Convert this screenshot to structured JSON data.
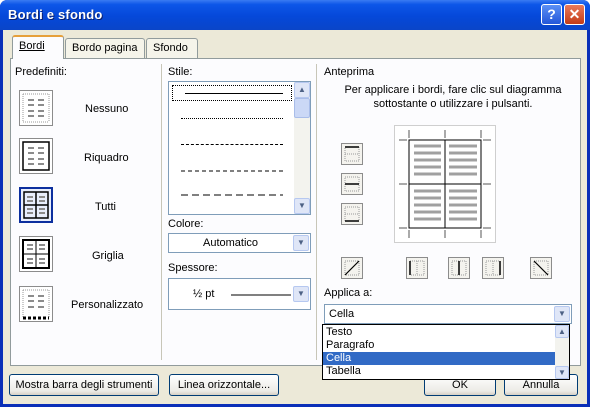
{
  "window": {
    "title": "Bordi e sfondo",
    "help_glyph": "?",
    "close_glyph": "✕"
  },
  "tabs": [
    {
      "label": "Bordi",
      "active": true
    },
    {
      "label": "Bordo pagina",
      "active": false
    },
    {
      "label": "Sfondo",
      "active": false
    }
  ],
  "presets": {
    "heading": "Predefiniti:",
    "items": [
      {
        "label": "Nessuno",
        "icon": "border-none-icon",
        "selected": false
      },
      {
        "label": "Riquadro",
        "icon": "border-box-icon",
        "selected": false
      },
      {
        "label": "Tutti",
        "icon": "border-all-icon",
        "selected": true
      },
      {
        "label": "Griglia",
        "icon": "border-grid-icon",
        "selected": false
      },
      {
        "label": "Personalizzato",
        "icon": "border-custom-icon",
        "selected": false
      }
    ]
  },
  "style": {
    "heading": "Stile:",
    "line_styles": [
      "solid",
      "dotted-fine",
      "dashed-small",
      "dashed-medium",
      "dash-dot",
      "dashed-long"
    ],
    "selected_index": 0
  },
  "color": {
    "label": "Colore:",
    "value": "Automatico"
  },
  "width": {
    "label": "Spessore:",
    "value": "½ pt"
  },
  "preview": {
    "heading": "Anteprima",
    "instructions": "Per applicare i bordi, fare clic sul diagramma sottostante o utilizzare i pulsanti."
  },
  "apply_to": {
    "label": "Applica a:",
    "value": "Cella",
    "options": [
      "Testo",
      "Paragrafo",
      "Cella",
      "Tabella"
    ],
    "selected_index": 2
  },
  "buttons": {
    "toolbar": "Mostra barra degli strumenti",
    "horizontal_line": "Linea orizzontale...",
    "ok": "OK",
    "cancel": "Annulla"
  },
  "colors": {
    "title_bar": "#0548d9",
    "dialog_bg": "#ece9d8",
    "selection": "#316ac5",
    "active_tab_accent": "#e6a03b"
  }
}
